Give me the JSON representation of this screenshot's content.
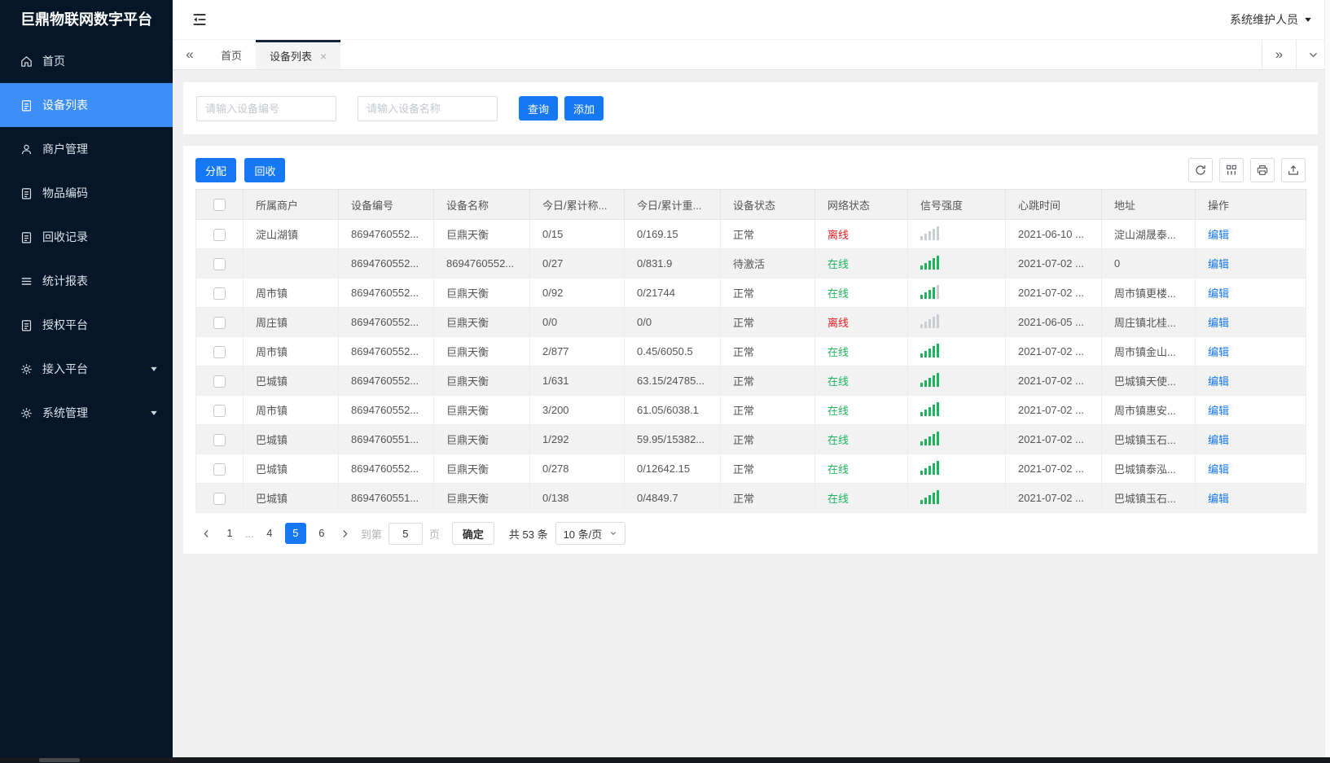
{
  "app": {
    "title": "巨鼎物联网数字平台",
    "user_name": "系统维护人员"
  },
  "sidebar": {
    "items": [
      {
        "name": "home",
        "icon": "home-icon",
        "label": "首页",
        "active": false,
        "caret": false
      },
      {
        "name": "device-list",
        "icon": "document-icon",
        "label": "设备列表",
        "active": true,
        "caret": false
      },
      {
        "name": "merchant-management",
        "icon": "user-icon",
        "label": "商户管理",
        "active": false,
        "caret": false
      },
      {
        "name": "item-code",
        "icon": "document-icon",
        "label": "物品编码",
        "active": false,
        "caret": false
      },
      {
        "name": "recycle-records",
        "icon": "document-icon",
        "label": "回收记录",
        "active": false,
        "caret": false
      },
      {
        "name": "statistics-report",
        "icon": "list-icon",
        "label": "统计报表",
        "active": false,
        "caret": false
      },
      {
        "name": "authorization-platform",
        "icon": "document-icon",
        "label": "授权平台",
        "active": false,
        "caret": false
      },
      {
        "name": "access-platform",
        "icon": "gear-icon",
        "label": "接入平台",
        "active": false,
        "caret": true
      },
      {
        "name": "system-management",
        "icon": "gear-icon",
        "label": "系统管理",
        "active": false,
        "caret": true
      }
    ]
  },
  "tabs": {
    "home": "首页",
    "device_list": "设备列表"
  },
  "search": {
    "device_no_placeholder": "请输入设备编号",
    "device_name_placeholder": "请输入设备名称",
    "query_label": "查询",
    "add_label": "添加"
  },
  "toolbar": {
    "assign_label": "分配",
    "recycle_label": "回收",
    "icon_buttons": [
      "refresh-icon",
      "columns-icon",
      "printer-icon",
      "export-icon"
    ]
  },
  "table": {
    "columns": [
      "所属商户",
      "设备编号",
      "设备名称",
      "今日/累计称...",
      "今日/累计重...",
      "设备状态",
      "网络状态",
      "信号强度",
      "心跳时间",
      "地址",
      "操作"
    ],
    "edit_label": "编辑",
    "signal_bars_total": 5,
    "rows": [
      {
        "merchant": "淀山湖镇",
        "device_no": "8694760552...",
        "device_name": "巨鼎天衡",
        "today_count": "0/15",
        "today_weight": "0/169.15",
        "device_status": "正常",
        "network_status": "离线",
        "online": false,
        "signal_level": 0,
        "heartbeat": "2021-06-10 ...",
        "address": "淀山湖晟泰..."
      },
      {
        "merchant": "",
        "device_no": "8694760552...",
        "device_name": "8694760552...",
        "today_count": "0/27",
        "today_weight": "0/831.9",
        "device_status": "待激活",
        "network_status": "在线",
        "online": true,
        "signal_level": 5,
        "heartbeat": "2021-07-02 ...",
        "address": "0"
      },
      {
        "merchant": "周市镇",
        "device_no": "8694760552...",
        "device_name": "巨鼎天衡",
        "today_count": "0/92",
        "today_weight": "0/21744",
        "device_status": "正常",
        "network_status": "在线",
        "online": true,
        "signal_level": 4,
        "heartbeat": "2021-07-02 ...",
        "address": "周市镇更楼..."
      },
      {
        "merchant": "周庄镇",
        "device_no": "8694760552...",
        "device_name": "巨鼎天衡",
        "today_count": "0/0",
        "today_weight": "0/0",
        "device_status": "正常",
        "network_status": "离线",
        "online": false,
        "signal_level": 0,
        "heartbeat": "2021-06-05 ...",
        "address": "周庄镇北桂..."
      },
      {
        "merchant": "周市镇",
        "device_no": "8694760552...",
        "device_name": "巨鼎天衡",
        "today_count": "2/877",
        "today_weight": "0.45/6050.5",
        "device_status": "正常",
        "network_status": "在线",
        "online": true,
        "signal_level": 5,
        "heartbeat": "2021-07-02 ...",
        "address": "周市镇金山..."
      },
      {
        "merchant": "巴城镇",
        "device_no": "8694760552...",
        "device_name": "巨鼎天衡",
        "today_count": "1/631",
        "today_weight": "63.15/24785...",
        "device_status": "正常",
        "network_status": "在线",
        "online": true,
        "signal_level": 5,
        "heartbeat": "2021-07-02 ...",
        "address": "巴城镇天使..."
      },
      {
        "merchant": "周市镇",
        "device_no": "8694760552...",
        "device_name": "巨鼎天衡",
        "today_count": "3/200",
        "today_weight": "61.05/6038.1",
        "device_status": "正常",
        "network_status": "在线",
        "online": true,
        "signal_level": 5,
        "heartbeat": "2021-07-02 ...",
        "address": "周市镇惠安..."
      },
      {
        "merchant": "巴城镇",
        "device_no": "8694760551...",
        "device_name": "巨鼎天衡",
        "today_count": "1/292",
        "today_weight": "59.95/15382...",
        "device_status": "正常",
        "network_status": "在线",
        "online": true,
        "signal_level": 5,
        "heartbeat": "2021-07-02 ...",
        "address": "巴城镇玉石..."
      },
      {
        "merchant": "巴城镇",
        "device_no": "8694760552...",
        "device_name": "巨鼎天衡",
        "today_count": "0/278",
        "today_weight": "0/12642.15",
        "device_status": "正常",
        "network_status": "在线",
        "online": true,
        "signal_level": 5,
        "heartbeat": "2021-07-02 ...",
        "address": "巴城镇泰泓..."
      },
      {
        "merchant": "巴城镇",
        "device_no": "8694760551...",
        "device_name": "巨鼎天衡",
        "today_count": "0/138",
        "today_weight": "0/4849.7",
        "device_status": "正常",
        "network_status": "在线",
        "online": true,
        "signal_level": 5,
        "heartbeat": "2021-07-02 ...",
        "address": "巴城镇玉石..."
      }
    ]
  },
  "pagination": {
    "pages": [
      "1",
      "...",
      "4",
      "5",
      "6"
    ],
    "active_page": "5",
    "goto_label": "到第",
    "goto_value": "5",
    "page_unit_label": "页",
    "confirm_label": "确定",
    "total_label": "共 53 条",
    "page_size_label": "10 条/页"
  },
  "colors": {
    "sidebar_bg": "#051628",
    "sidebar_active_blue": "#3e8ef7",
    "accent_blue": "#1678f2",
    "online_green": "#1db35c",
    "offline_red": "#e61c1c",
    "header_row_bg": "#f2f2f2"
  }
}
